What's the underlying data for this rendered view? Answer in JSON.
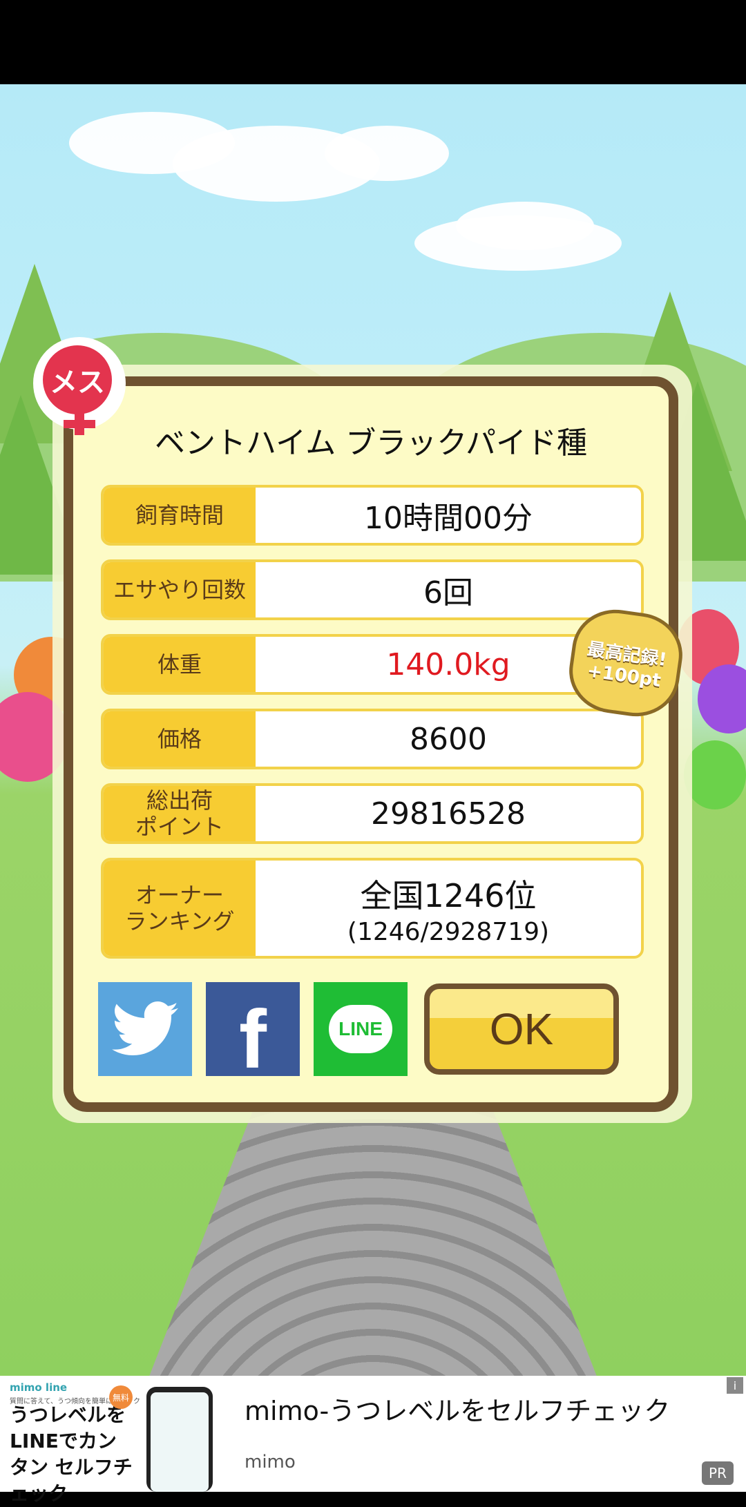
{
  "dialog": {
    "title": "ベントハイム ブラックパイド種",
    "gender_badge": "メス",
    "rows": [
      {
        "label": "飼育時間",
        "value": "10時間00分"
      },
      {
        "label": "エサやり回数",
        "value": "6回"
      },
      {
        "label": "体重",
        "value": "140.0kg"
      },
      {
        "label": "価格",
        "value": "8600"
      },
      {
        "label": "総出荷\nポイント",
        "value": "29816528"
      }
    ],
    "ranking": {
      "label": "オーナー\nランキング",
      "main": "全国1246位",
      "sub": "(1246/2928719)"
    },
    "record_badge": {
      "line1": "最高記録!",
      "line2": "+100pt"
    },
    "ok_label": "OK",
    "share": {
      "facebook_glyph": "f",
      "line_label": "LINE"
    }
  },
  "ad": {
    "brand": "mimo line",
    "small_text": "質問に答えて、うつ傾向を簡単にチェック",
    "copy": "うつレベルを LINEでカンタン セルフチェック",
    "badge": "無料",
    "title": "mimo-うつレベルをセルフチェック",
    "sponsor": "mimo",
    "pr": "PR",
    "info": "i"
  },
  "colors": {
    "accent": "#f7cc32",
    "frame": "#6f5230",
    "highlight_value": "#e01a20"
  }
}
